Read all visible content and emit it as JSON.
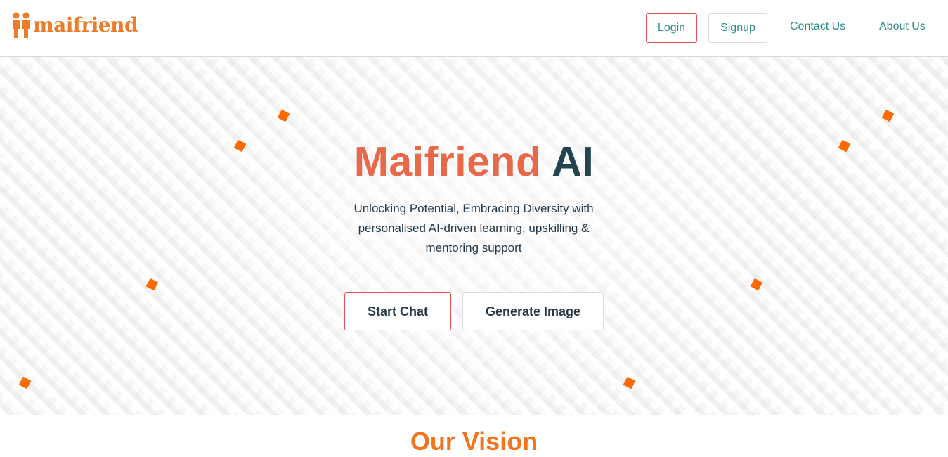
{
  "brand": {
    "logo_text": "maifriend",
    "logo_icon": "two-people-icon",
    "accent_color": "#ee7b27"
  },
  "nav": {
    "login": "Login",
    "signup": "Signup",
    "contact": "Contact Us",
    "about": "About Us"
  },
  "hero": {
    "title_part1": "Maifriend",
    "title_part2": "AI",
    "subtitle": "Unlocking Potential, Embracing Diversity with personalised AI-driven learning, upskilling & mentoring support",
    "primary_button": "Start Chat",
    "secondary_button": "Generate Image"
  },
  "vision": {
    "title": "Our Vision"
  }
}
